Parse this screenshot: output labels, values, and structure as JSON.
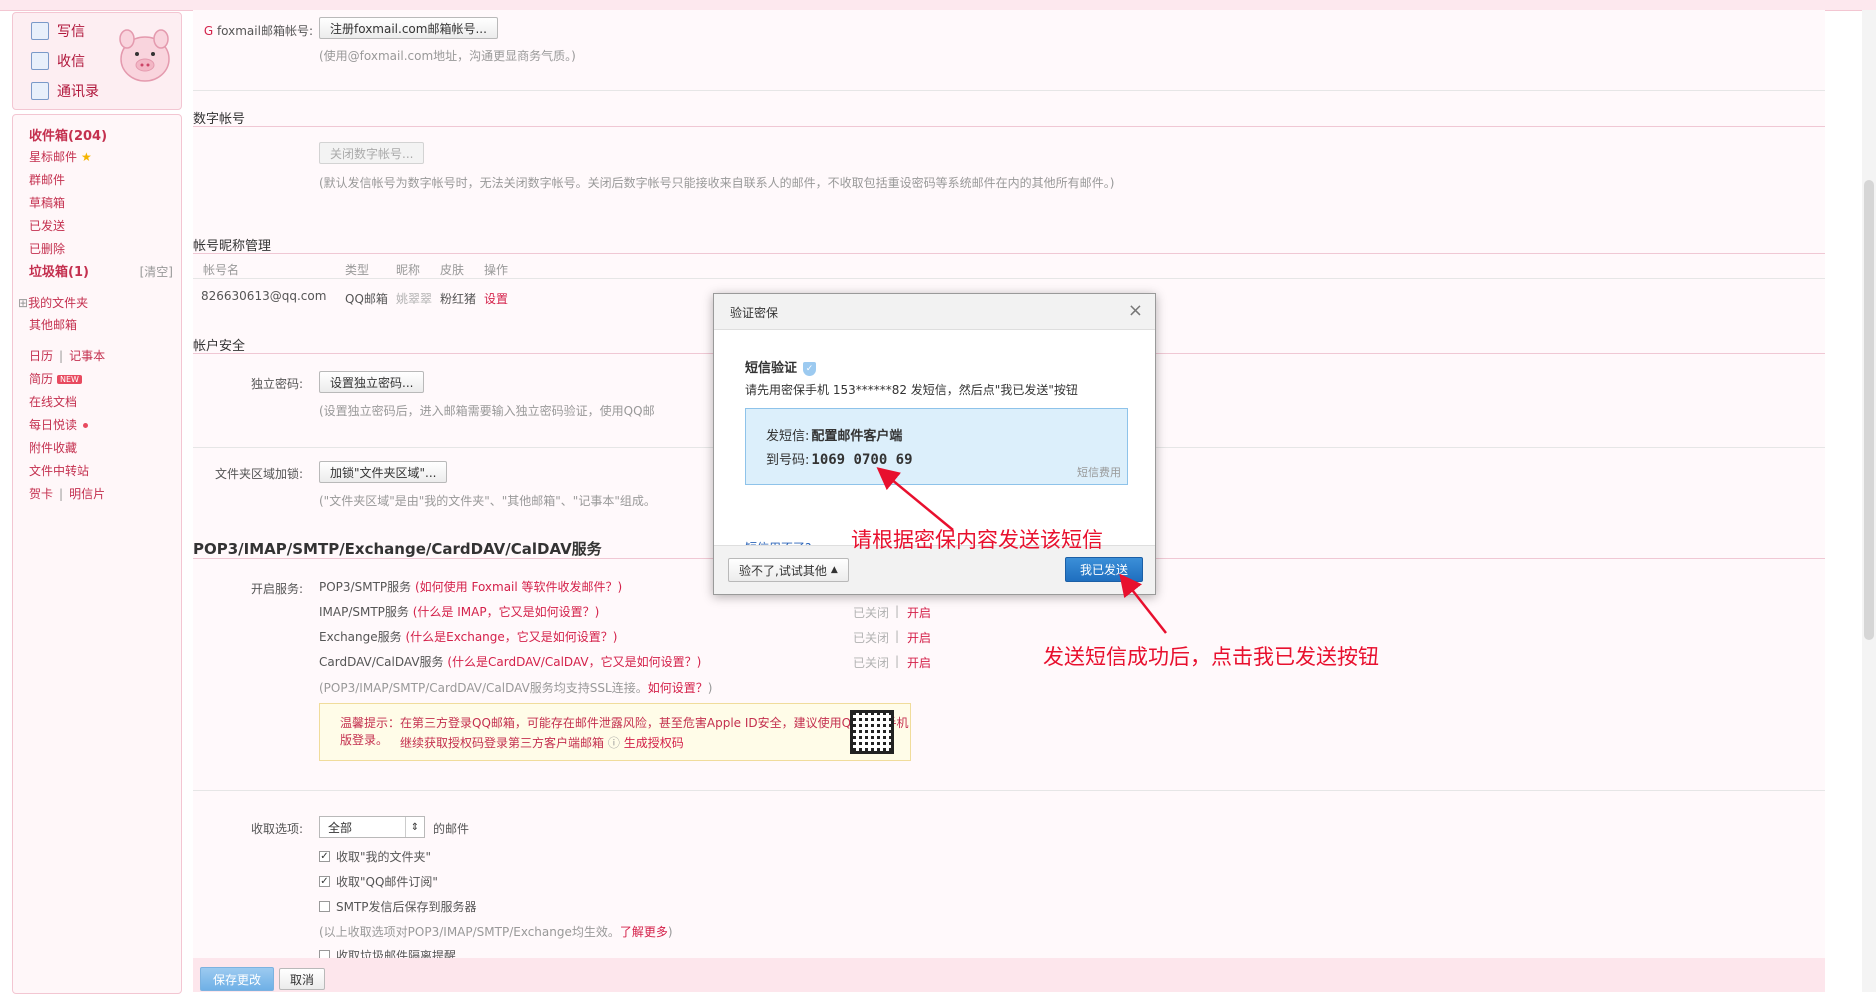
{
  "sidebar": {
    "compose": "写信",
    "inbox": "收信",
    "contacts": "通讯录",
    "folders": [
      {
        "label": "收件箱(204)",
        "bold": true
      },
      {
        "label": "星标邮件"
      },
      {
        "label": "群邮件"
      },
      {
        "label": "草稿箱"
      },
      {
        "label": "已发送"
      },
      {
        "label": "已删除"
      },
      {
        "label": "垃圾箱(1)",
        "bold": true
      }
    ],
    "clean_label": "[清空]",
    "my_folders": "我的文件夹",
    "other_mailbox": "其他邮箱",
    "calendar": "日历",
    "notebook": "记事本",
    "resume": "简历",
    "new_badge": "NEW",
    "online_docs": "在线文档",
    "daily_read": "每日悦读",
    "attachments": "附件收藏",
    "transfer": "文件中转站",
    "card": "贺卡",
    "postcard": "明信片"
  },
  "foxmail": {
    "label": "foxmail邮箱帐号:",
    "button": "注册foxmail.com邮箱帐号...",
    "hint": "(使用@foxmail.com地址，沟通更显商务气质。)"
  },
  "digital": {
    "title": "数字帐号",
    "button": "关闭数字帐号...",
    "hint": "(默认发信帐号为数字帐号时，无法关闭数字帐号。关闭后数字帐号只能接收来自联系人的邮件，不收取包括重设密码等系统邮件在内的其他所有邮件。)"
  },
  "nickname": {
    "title": "帐号昵称管理",
    "headers": [
      "帐号名",
      "类型",
      "昵称",
      "皮肤",
      "操作"
    ],
    "row": {
      "account": "826630613@qq.com",
      "type": "QQ邮箱",
      "nick": "姚翠翠",
      "skin": "粉红猪",
      "action": "设置"
    }
  },
  "security": {
    "title": "帐户安全",
    "pwd_label": "独立密码:",
    "pwd_button": "设置独立密码...",
    "pwd_hint": "(设置独立密码后，进入邮箱需要输入独立密码验证，使用QQ邮",
    "lock_label": "文件夹区域加锁:",
    "lock_button": "加锁\"文件夹区域\"...",
    "lock_hint": "(\"文件夹区域\"是由\"我的文件夹\"、\"其他邮箱\"、\"记事本\"组成。"
  },
  "pop3": {
    "title": "POP3/IMAP/SMTP/Exchange/CardDAV/CalDAV服务",
    "label": "开启服务:",
    "services": [
      {
        "name": "POP3/SMTP服务",
        "help": "(如何使用 Foxmail 等软件收发邮件？)",
        "status": "",
        "action": ""
      },
      {
        "name": "IMAP/SMTP服务",
        "help": "(什么是 IMAP，它又是如何设置？)",
        "status": "已关闭",
        "action": "开启"
      },
      {
        "name": "Exchange服务",
        "help": "(什么是Exchange，它又是如何设置？)",
        "status": "已关闭",
        "action": "开启"
      },
      {
        "name": "CardDAV/CalDAV服务",
        "help": "(什么是CardDAV/CalDAV，它又是如何设置？)",
        "status": "已关闭",
        "action": "开启"
      }
    ],
    "ssl_hint": "(POP3/IMAP/SMTP/CardDAV/CalDAV服务均支持SSL连接。",
    "ssl_link": "如何设置？",
    "ssl_end": ")",
    "warn_line1": "温馨提示：在第三方登录QQ邮箱，可能存在邮件泄露风险，甚至危害Apple ID安全，建议使用QQ邮箱手机版登录。",
    "warn_line2": "继续获取授权码登录第三方客户端邮箱",
    "warn_link": "生成授权码"
  },
  "receive": {
    "label": "收取选项:",
    "select_value": "全部",
    "suffix": "的邮件",
    "options": [
      {
        "label": "收取\"我的文件夹\"",
        "checked": true
      },
      {
        "label": "收取\"QQ邮件订阅\"",
        "checked": true
      },
      {
        "label": "SMTP发信后保存到服务器",
        "checked": false
      }
    ],
    "scope_hint": "(以上收取选项对POP3/IMAP/SMTP/Exchange均生效。",
    "scope_link": "了解更多",
    "scope_end": ")",
    "spam_option": "收取垃圾邮件隔离提醒"
  },
  "footer": {
    "save": "保存更改",
    "cancel": "取消"
  },
  "modal": {
    "title": "验证密保",
    "close": "×",
    "sms_title": "短信验证",
    "instruction": "请先用密保手机 153******82 发短信，然后点\"我已发送\"按钮",
    "send_label": "发短信:",
    "send_content": "配置邮件客户端",
    "to_label": "到号码:",
    "to_number": "1069 0700 69",
    "fee": "短信费用",
    "unavailable": "短信用不了?",
    "other_button": "验不了,试试其他",
    "sent_button": "我已发送"
  },
  "annotations": {
    "note1": "请根据密保内容发送该短信",
    "note2": "发送短信成功后，点击我已发送按钮"
  }
}
